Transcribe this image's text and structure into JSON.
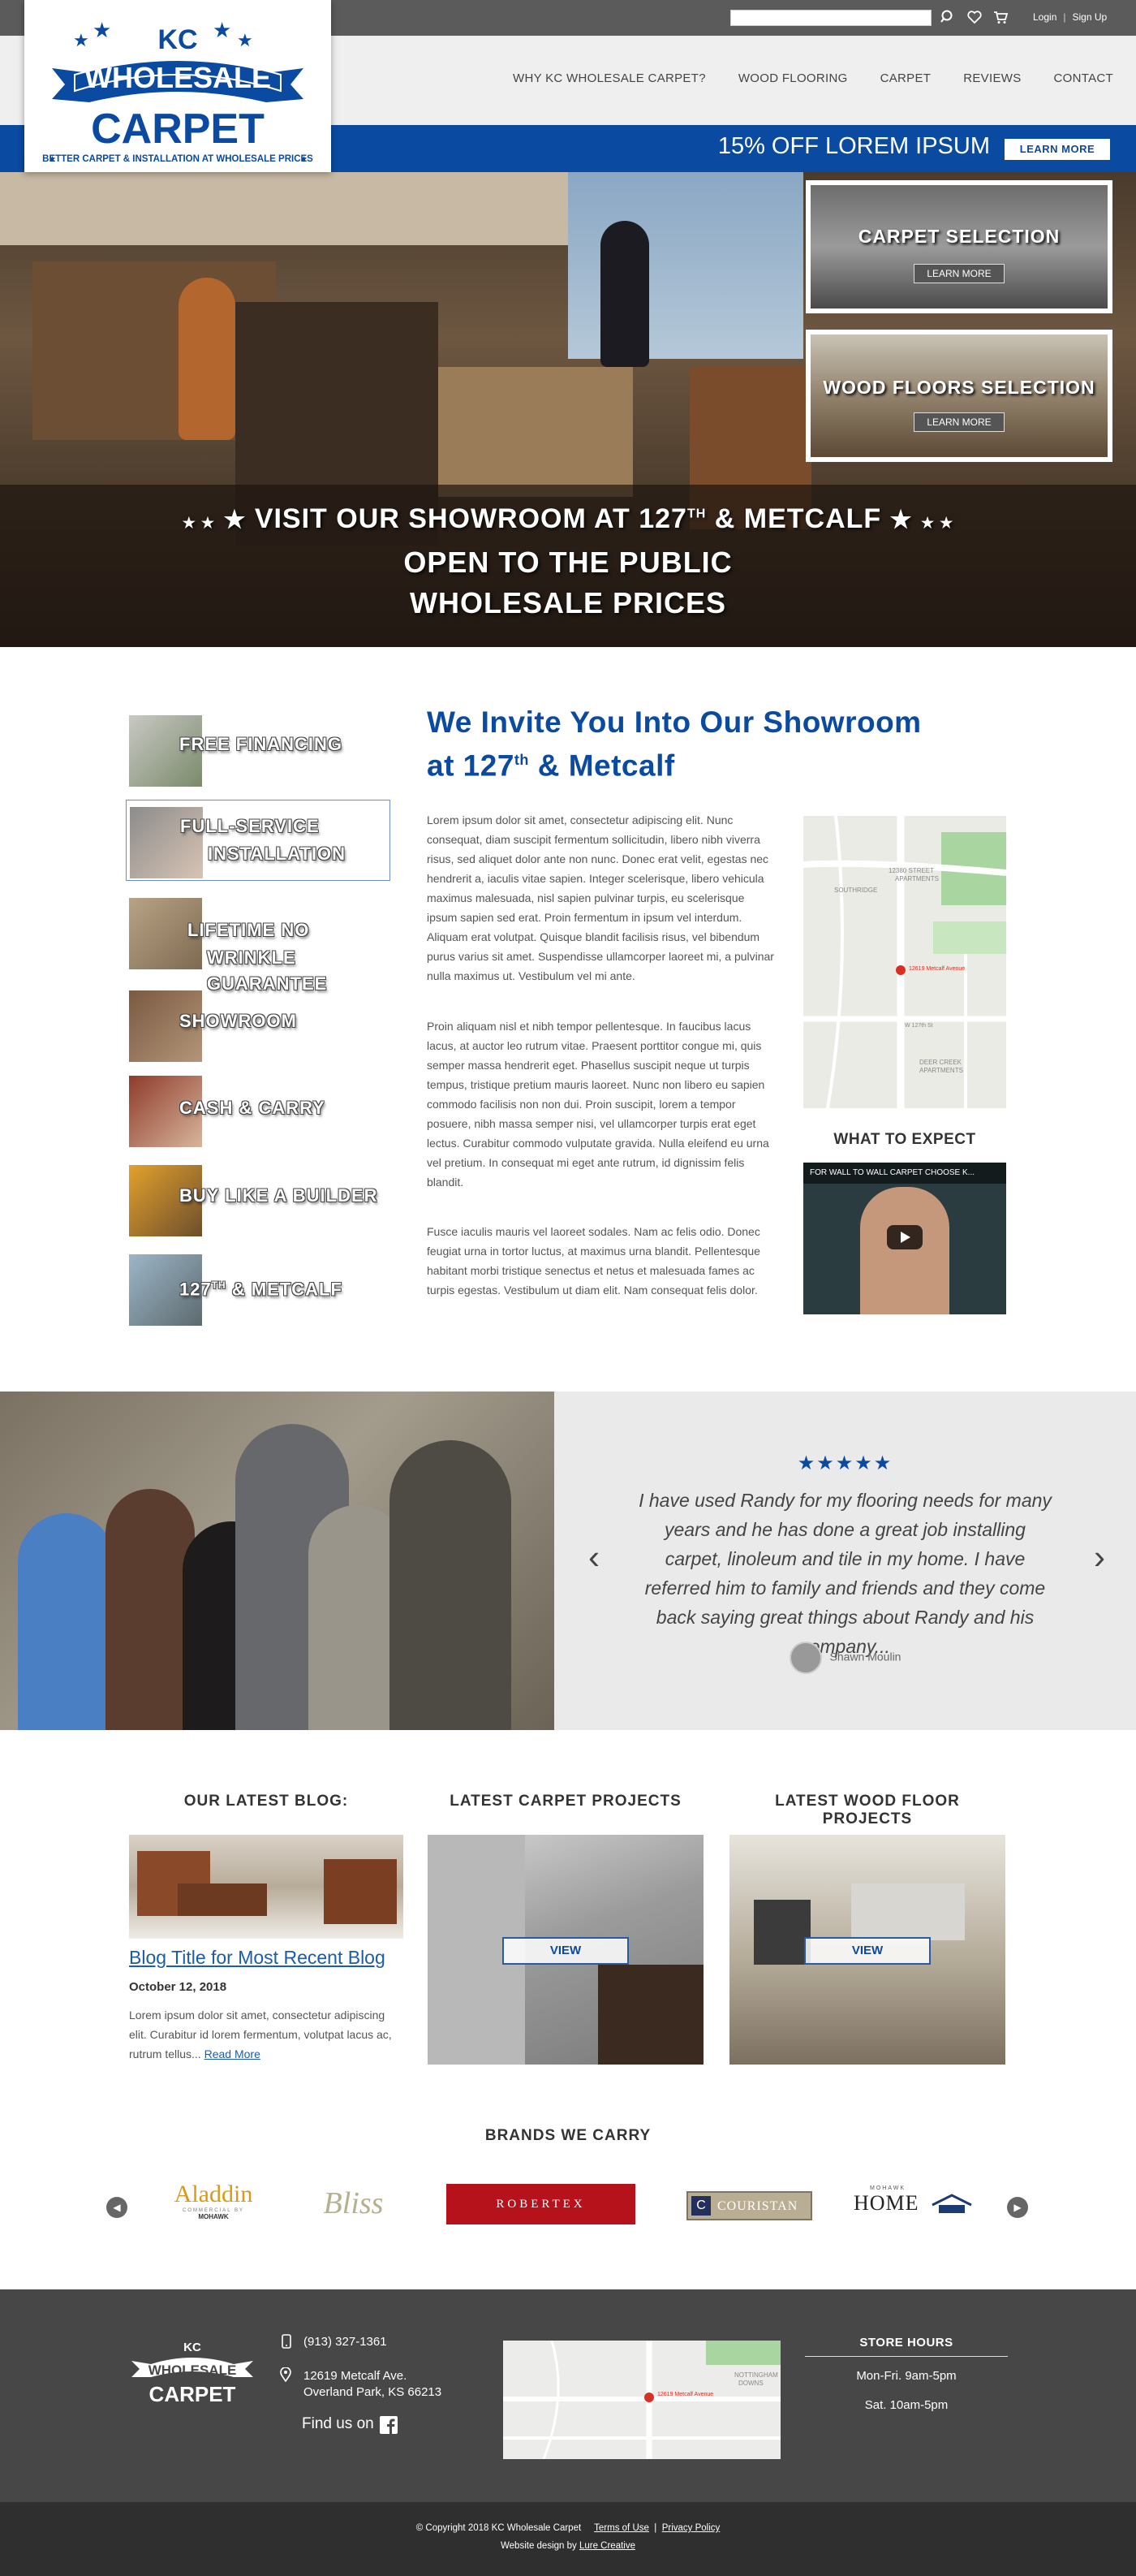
{
  "topbar": {
    "search_placeholder": "",
    "login": "Login",
    "separator": "|",
    "signup": "Sign Up",
    "icons": [
      "search-icon",
      "heart-icon",
      "cart-icon"
    ]
  },
  "logo": {
    "kc": "KC",
    "wholesale": "WHOLESALE",
    "carpet": "CARPET",
    "tagline": "BETTER CARPET & INSTALLATION AT WHOLESALE PRICES"
  },
  "nav": {
    "items": [
      "WHY KC WHOLESALE CARPET?",
      "WOOD FLOORING",
      "CARPET",
      "REVIEWS",
      "CONTACT"
    ]
  },
  "promo": {
    "text": "15% OFF LOREM IPSUM",
    "button": "LEARN MORE"
  },
  "hero": {
    "cards": [
      {
        "title": "CARPET SELECTION",
        "button": "LEARN MORE"
      },
      {
        "title": "WOOD FLOORS SELECTION",
        "button": "LEARN MORE"
      }
    ],
    "line1_pre": "VISIT OUR SHOWROOM AT 127",
    "line1_sup": "TH",
    "line1_post": " & METCALF",
    "line2": "OPEN TO THE PUBLIC",
    "line3": "WHOLESALE PRICES"
  },
  "features": [
    {
      "line1": "FREE FINANCING",
      "line2": ""
    },
    {
      "line1": "FULL-SERVICE",
      "line2": "INSTALLATION"
    },
    {
      "line1": "LIFETIME NO",
      "line2": "WRINKLE GUARANTEE"
    },
    {
      "line1": "SHOWROOM",
      "line2": ""
    },
    {
      "line1": "CASH & CARRY",
      "line2": ""
    },
    {
      "line1": "BUY LIKE A BUILDER",
      "line2": ""
    },
    {
      "line1_pre": "127",
      "line1_sup": "TH",
      "line1_post": " & METCALF"
    }
  ],
  "intro": {
    "title_line1": "We Invite You Into Our Showroom",
    "title_line2_pre": "at 127",
    "title_line2_sup": "th",
    "title_line2_post": " & Metcalf",
    "paragraphs": [
      "Lorem ipsum dolor sit amet, consectetur adipiscing elit. Nunc consequat, diam suscipit fermentum sollicitudin, libero nibh viverra risus, sed aliquet dolor ante non nunc. Donec erat velit, egestas nec hendrerit a, iaculis vitae sapien. Integer scelerisque, libero vehicula maximus malesuada, nisl sapien pulvinar turpis, eu scelerisque ipsum sapien sed erat. Proin fermentum in ipsum vel interdum. Aliquam erat volutpat. Quisque blandit facilisis risus, vel bibendum purus varius sit amet. Suspendisse ullamcorper laoreet mi, a pulvinar nulla maximus ut. Vestibulum vel mi ante.",
      "Proin aliquam nisl et nibh tempor pellentesque. In faucibus lacus lacus, at auctor leo rutrum vitae. Praesent porttitor congue mi, quis semper massa hendrerit eget. Phasellus suscipit neque ut turpis tempus, tristique pretium mauris laoreet. Nunc non libero eu sapien commodo facilisis non non dui. Proin suscipit, lorem a tempor posuere, nibh massa semper nisi, vel ullamcorper turpis erat eget lectus. Curabitur commodo vulputate gravida. Nulla eleifend eu urna vel pretium. In consequat mi eget ante rutrum, id dignissim felis blandit.",
      "Fusce iaculis mauris vel laoreet sodales. Nam ac felis odio. Donec feugiat urna in tortor luctus, at maximus urna blandit. Pellentesque habitant morbi tristique senectus et netus et malesuada fames ac turpis egestas. Vestibulum ut diam elit. Nam consequat felis dolor."
    ],
    "map_labels": {
      "apartments1": "12380 STREET\nAPARTMENTS",
      "southridge": "SOUTHRIDGE",
      "pin": "12619 Metcalf Avenue",
      "deer_creek": "DEER CREEK\nAPARTMENTS",
      "street": "W 127th St"
    },
    "what_to_expect": "WHAT TO EXPECT",
    "video_title": "FOR WALL TO WALL CARPET CHOOSE K..."
  },
  "testimonial": {
    "stars": "★★★★★",
    "quote": "I have used Randy for my flooring needs for many years and he has done a great job installing carpet, linoleum and tile in my home. I have referred him to family and friends and they come back saying great things about Randy and his company...",
    "author": "Shawn Moulin"
  },
  "blog": {
    "heading": "OUR LATEST BLOG:",
    "title": "Blog Title for Most Recent Blog",
    "date": "October 12, 2018",
    "excerpt": "Lorem ipsum dolor sit amet, consectetur adipiscing elit. Curabitur id lorem fermentum, volutpat lacus ac, rutrum tellus...",
    "read_more": "Read More"
  },
  "projects": {
    "carpet_heading": "LATEST CARPET PROJECTS",
    "wood_heading": "LATEST WOOD FLOOR PROJECTS",
    "view": "VIEW"
  },
  "brands": {
    "heading": "BRANDS WE CARRY",
    "items": {
      "aladdin": "Aladdin",
      "aladdin_sub": "COMMERCIAL BY",
      "aladdin_sub2": "MOHAWK",
      "bliss": "Bliss",
      "robertex": "ROBERTEX",
      "couristan": "COURISTAN",
      "home_small": "MOHAWK",
      "home": "HOME"
    }
  },
  "footer": {
    "phone": "(913) 327-1361",
    "address1": "12619 Metcalf Ave.",
    "address2": "Overland Park, KS 66213",
    "find_us": "Find us on",
    "hours_title": "STORE HOURS",
    "hours1": "Mon-Fri. 9am-5pm",
    "hours2": "Sat. 10am-5pm",
    "map_label": "12619 Metcalf Avenue",
    "map_area": "NOTTINGHAM\nDOWNS"
  },
  "bottom": {
    "copyright": "© Copyright 2018 KC Wholesale Carpet",
    "terms": "Terms of Use",
    "sep": "|",
    "privacy": "Privacy Policy",
    "design_pre": "Website design by ",
    "design_link": "Lure Creative"
  },
  "colors": {
    "brand_blue": "#0b4aa1",
    "topbar": "#5b5b5b",
    "footer": "#474747",
    "bottom": "#2f2f2f"
  }
}
